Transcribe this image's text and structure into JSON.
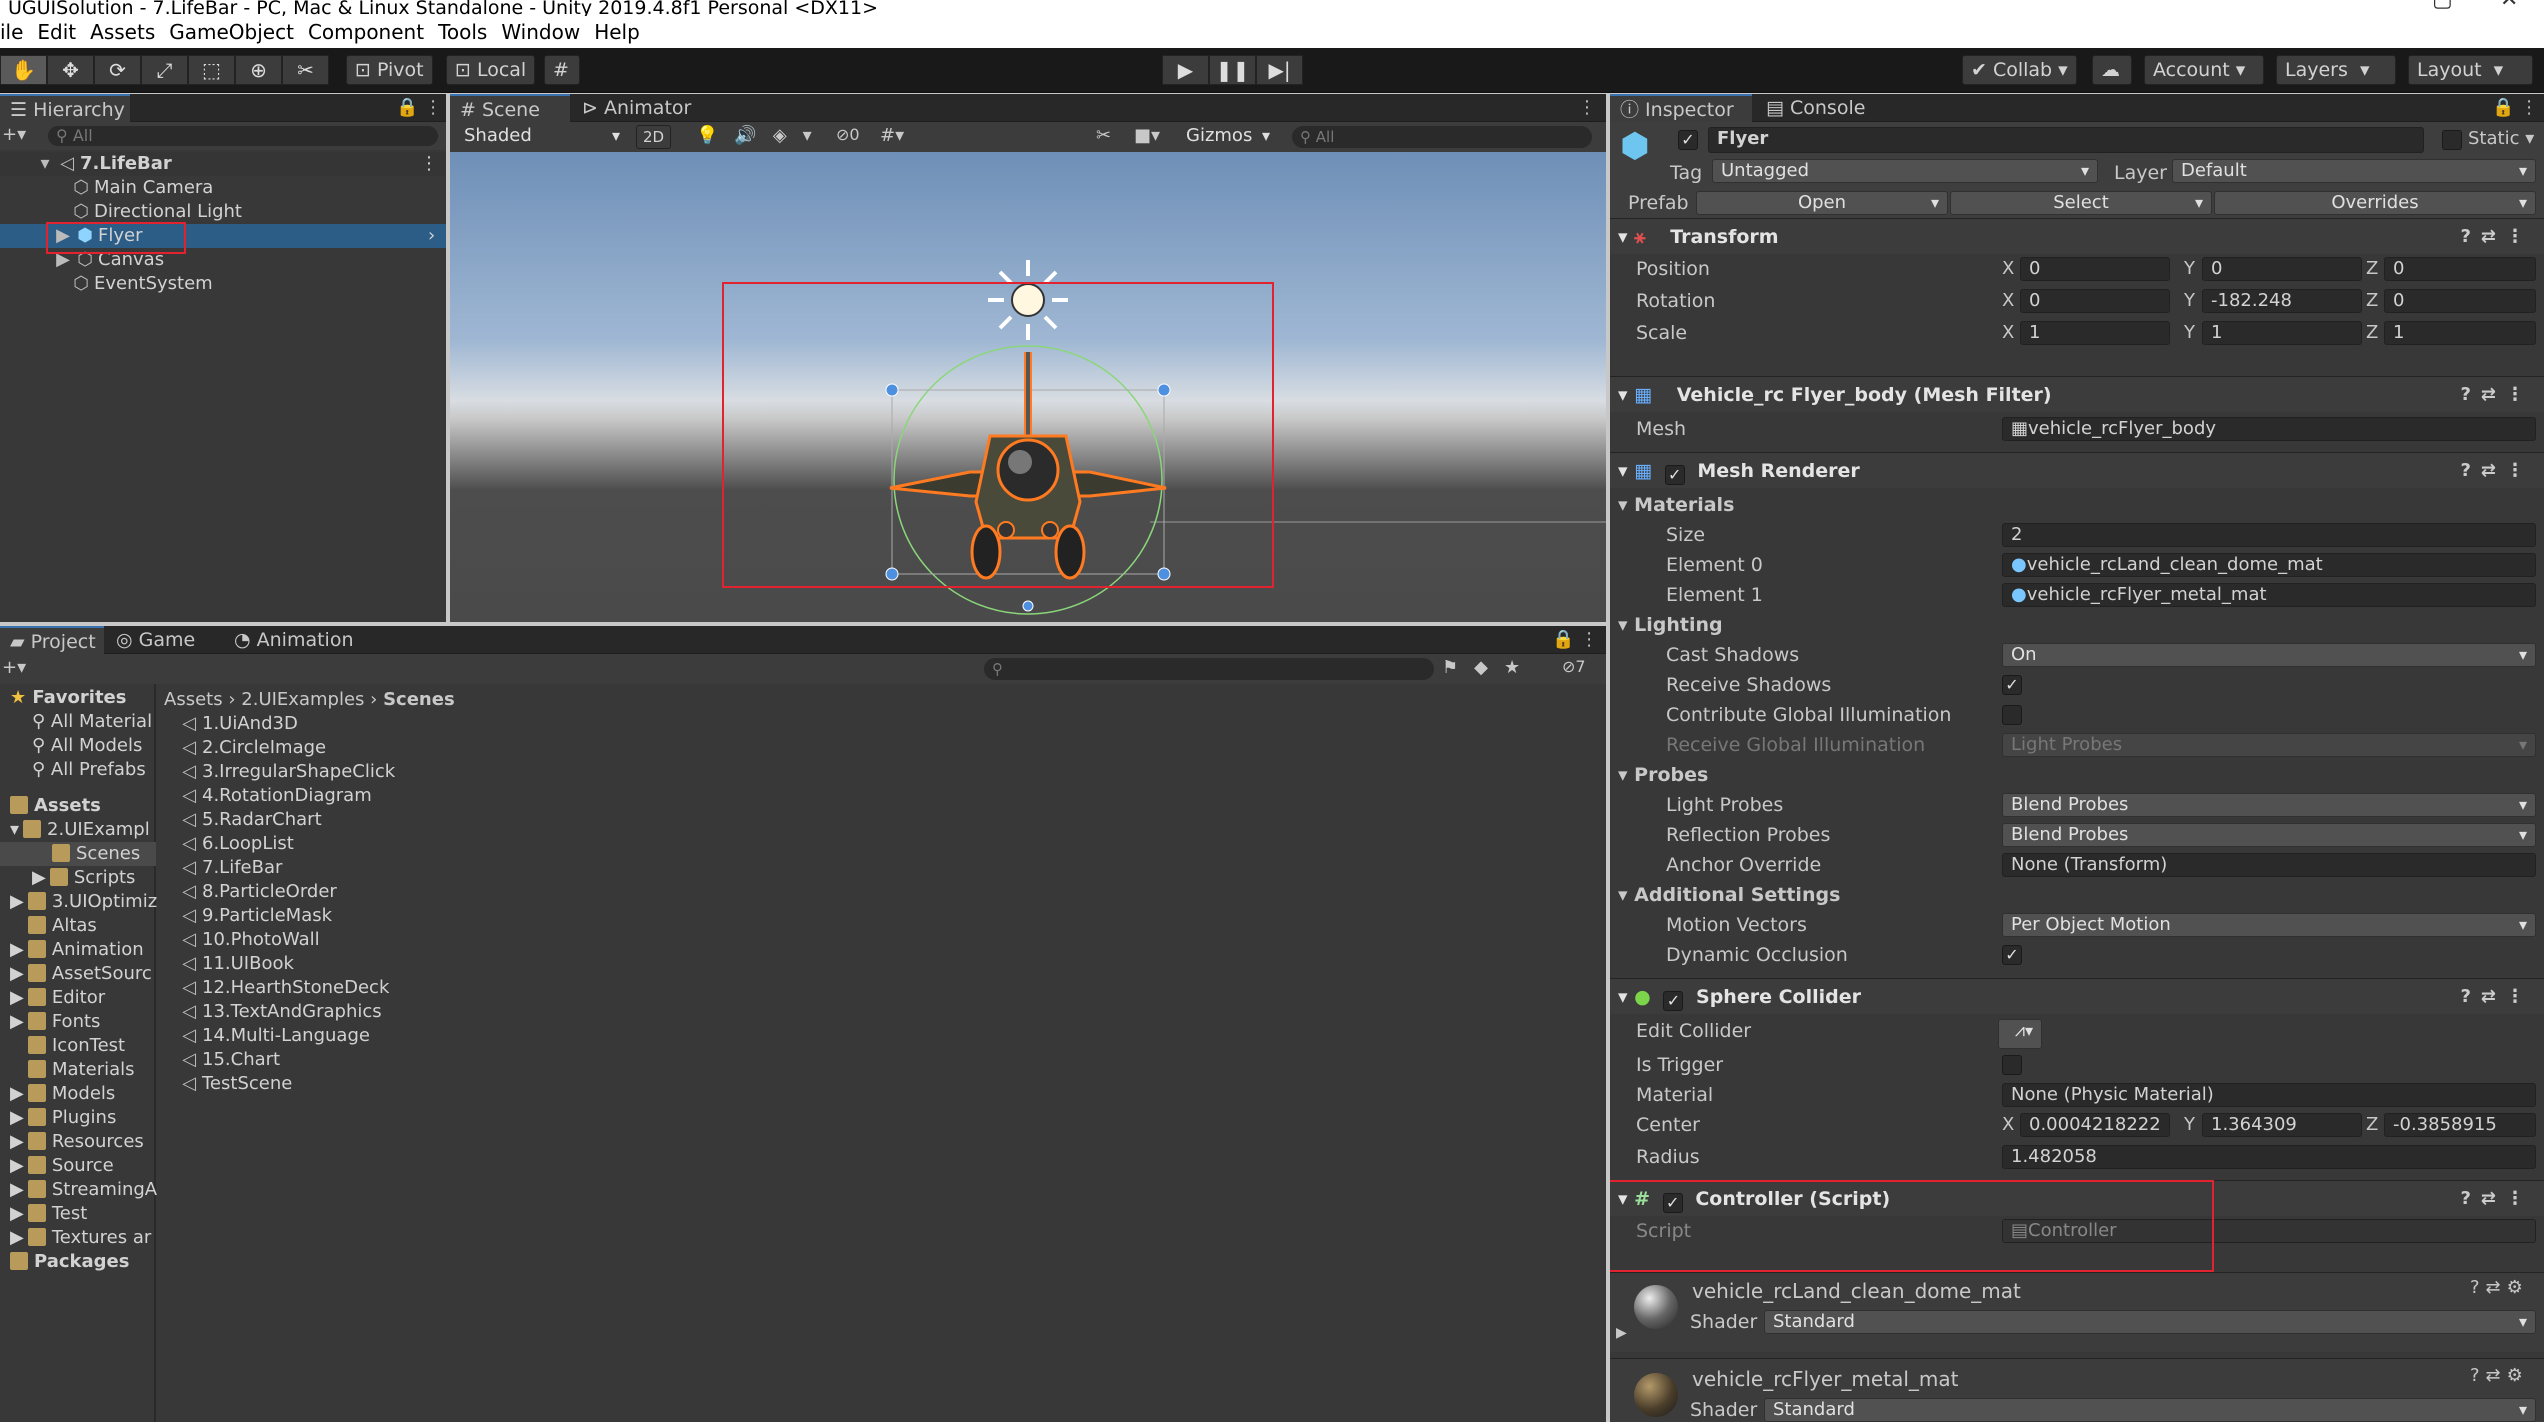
{
  "window": {
    "title": "UGUISolution - 7.LifeBar - PC, Mac & Linux Standalone - Unity 2019.4.8f1 Personal <DX11>"
  },
  "menu": [
    "ile",
    "Edit",
    "Assets",
    "GameObject",
    "Component",
    "Tools",
    "Window",
    "Help"
  ],
  "toolbar": {
    "pivot": "Pivot",
    "local": "Local",
    "collab": "Collab ▾",
    "account": "Account",
    "layers": "Layers",
    "layout": "Layout"
  },
  "hierarchy": {
    "tab": "Hierarchy",
    "search_placeholder": "All",
    "scene": "7.LifeBar",
    "items": [
      "Main Camera",
      "Directional Light",
      "Flyer",
      "Canvas",
      "EventSystem"
    ]
  },
  "scene": {
    "tab_scene": "Scene",
    "tab_animator": "Animator",
    "shading": "Shaded",
    "mode2d": "2D",
    "gizmos": "Gizmos",
    "search_placeholder": "All",
    "hidden_count": "0"
  },
  "project": {
    "tab_project": "Project",
    "tab_game": "Game",
    "tab_animation": "Animation",
    "hidden_count": "7",
    "favorites_label": "Favorites",
    "favorites": [
      "All Material",
      "All Models",
      "All Prefabs"
    ],
    "assets_label": "Assets",
    "folders": [
      "2.UIExampl",
      "Scenes",
      "Scripts",
      "3.UIOptimiz",
      "Altas",
      "Animation",
      "AssetSourc",
      "Editor",
      "Fonts",
      "IconTest",
      "Materials",
      "Models",
      "Plugins",
      "Resources",
      "Source",
      "StreamingA",
      "Test",
      "Textures ar"
    ],
    "packages_label": "Packages",
    "breadcrumb": [
      "Assets",
      "2.UIExamples",
      "Scenes"
    ],
    "scenes": [
      "1.UiAnd3D",
      "2.CircleImage",
      "3.IrregularShapeClick",
      "4.RotationDiagram",
      "5.RadarChart",
      "6.LoopList",
      "7.LifeBar",
      "8.ParticleOrder",
      "9.ParticleMask",
      "10.PhotoWall",
      "11.UIBook",
      "12.HearthStoneDeck",
      "13.TextAndGraphics",
      "14.Multi-Language",
      "15.Chart",
      "TestScene"
    ]
  },
  "inspector": {
    "tab_inspector": "Inspector",
    "tab_console": "Console",
    "name": "Flyer",
    "static_label": "Static",
    "tag_label": "Tag",
    "tag": "Untagged",
    "layer_label": "Layer",
    "layer": "Default",
    "prefab_label": "Prefab",
    "prefab_open": "Open",
    "prefab_select": "Select",
    "prefab_overrides": "Overrides",
    "transform": {
      "title": "Transform",
      "position_label": "Position",
      "rotation_label": "Rotation",
      "scale_label": "Scale",
      "position": [
        "0",
        "0",
        "0"
      ],
      "rotation": [
        "0",
        "-182.248",
        "0"
      ],
      "scale": [
        "1",
        "1",
        "1"
      ]
    },
    "meshfilter": {
      "title": "Vehicle_rc Flyer_body (Mesh Filter)",
      "mesh_label": "Mesh",
      "mesh": "vehicle_rcFlyer_body"
    },
    "meshrenderer": {
      "title": "Mesh Renderer",
      "materials_label": "Materials",
      "size_label": "Size",
      "size": "2",
      "element0_label": "Element 0",
      "element0": "vehicle_rcLand_clean_dome_mat",
      "element1_label": "Element 1",
      "element1": "vehicle_rcFlyer_metal_mat",
      "lighting_label": "Lighting",
      "cast_shadows_label": "Cast Shadows",
      "cast_shadows": "On",
      "receive_shadows_label": "Receive Shadows",
      "contribute_gi_label": "Contribute Global Illumination",
      "receive_gi_label": "Receive Global Illumination",
      "receive_gi": "Light Probes",
      "probes_label": "Probes",
      "light_probes_label": "Light Probes",
      "light_probes": "Blend Probes",
      "reflection_probes_label": "Reflection Probes",
      "reflection_probes": "Blend Probes",
      "anchor_label": "Anchor Override",
      "anchor": "None (Transform)",
      "additional_label": "Additional Settings",
      "motion_vectors_label": "Motion Vectors",
      "motion_vectors": "Per Object Motion",
      "dynamic_occlusion_label": "Dynamic Occlusion"
    },
    "spherecollider": {
      "title": "Sphere Collider",
      "edit_label": "Edit Collider",
      "trigger_label": "Is Trigger",
      "material_label": "Material",
      "material": "None (Physic Material)",
      "center_label": "Center",
      "center": [
        "0.0004218222",
        "1.364309",
        "-0.3858915"
      ],
      "radius_label": "Radius",
      "radius": "1.482058"
    },
    "controller": {
      "title": "Controller (Script)",
      "script_label": "Script",
      "script": "Controller"
    },
    "mat1": {
      "name": "vehicle_rcLand_clean_dome_mat",
      "shader_label": "Shader",
      "shader": "Standard"
    },
    "mat2": {
      "name": "vehicle_rcFlyer_metal_mat",
      "shader_label": "Shader",
      "shader": "Standard"
    }
  },
  "colors": {
    "highlight": "#e0232f",
    "selection": "#2c5d87",
    "panel": "#383838"
  }
}
